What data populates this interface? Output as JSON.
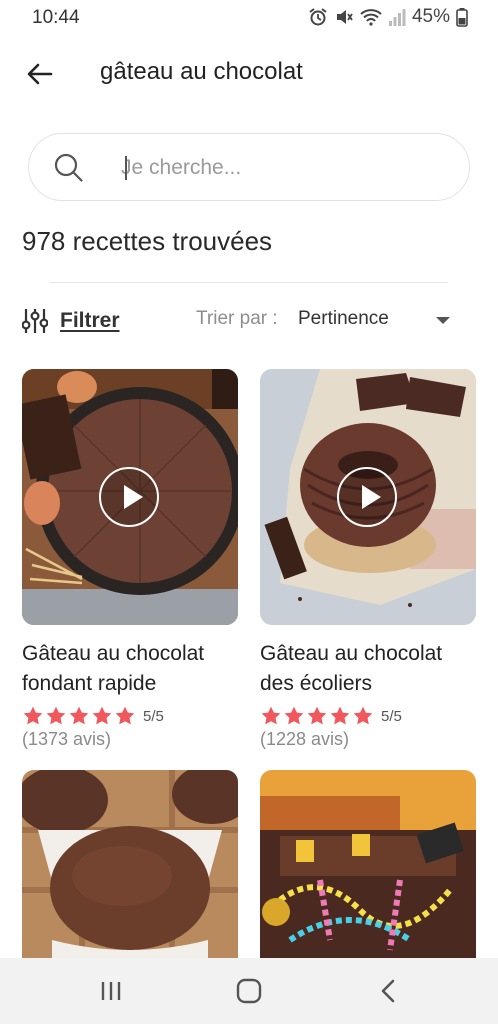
{
  "status_bar": {
    "time": "10:44",
    "battery": "45%"
  },
  "header": {
    "title": "gâteau au chocolat"
  },
  "search": {
    "placeholder": "Je cherche..."
  },
  "results": {
    "count_text": "978 recettes trouvées"
  },
  "filter": {
    "label": "Filtrer"
  },
  "sort": {
    "label": "Trier par :",
    "selected": "Pertinence"
  },
  "colors": {
    "star": "#f0585e",
    "text": "#222222",
    "muted": "#8a8a8a",
    "navbar": "#f2f2f2"
  },
  "recipes": [
    {
      "title": "Gâteau au chocolat fondant rapide",
      "score": "5/5",
      "reviews": "(1373 avis)",
      "rating": 5,
      "has_video": true
    },
    {
      "title": "Gâteau au chocolat des écoliers",
      "score": "5/5",
      "reviews": "(1228 avis)",
      "rating": 5,
      "has_video": true
    },
    {
      "title": "",
      "score": "",
      "reviews": "",
      "has_video": false
    },
    {
      "title": "",
      "score": "",
      "reviews": "",
      "has_video": false
    }
  ],
  "icons": [
    "back-arrow-icon",
    "search-icon",
    "filter-sliders-icon",
    "play-icon",
    "star-icon",
    "recent-apps-icon",
    "home-icon",
    "nav-back-icon"
  ]
}
